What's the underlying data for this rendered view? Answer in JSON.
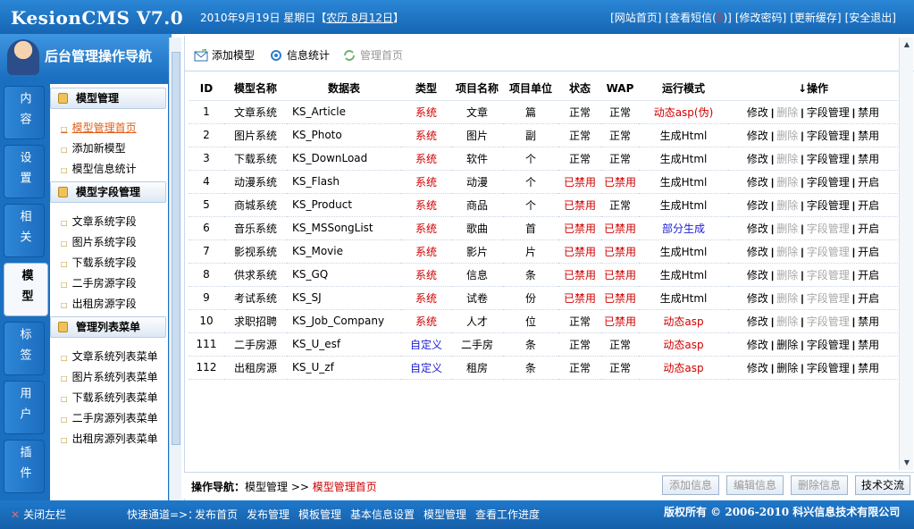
{
  "header": {
    "logo": "KesionCMS V7.0",
    "date": "2010年9月19日 星期日【",
    "lunar": "农历 8月12日",
    "date_close": "】",
    "links": [
      "[网站首页]",
      "[查看短信(",
      "0",
      ")]",
      "[修改密码]",
      "[更新缓存]",
      "[安全退出]"
    ]
  },
  "sidebar": {
    "title": "后台管理操作导航",
    "tabs": [
      "内容",
      "设置",
      "相关",
      "模型",
      "标签",
      "用户",
      "插件"
    ],
    "active_tab": "模型",
    "groups": [
      {
        "title": "模型管理",
        "items": [
          "模型管理首页",
          "添加新模型",
          "模型信息统计"
        ]
      },
      {
        "title": "模型字段管理",
        "items": [
          "文章系统字段",
          "图片系统字段",
          "下载系统字段",
          "二手房源字段",
          "出租房源字段"
        ]
      },
      {
        "title": "管理列表菜单",
        "items": [
          "文章系统列表菜单",
          "图片系统列表菜单",
          "下载系统列表菜单",
          "二手房源列表菜单",
          "出租房源列表菜单"
        ]
      }
    ]
  },
  "toolbar": {
    "add": "添加模型",
    "stats": "信息统计",
    "home": "管理首页"
  },
  "table": {
    "headers": [
      "ID",
      "模型名称",
      "数据表",
      "类型",
      "项目名称",
      "项目单位",
      "状态",
      "WAP",
      "运行模式",
      "↓操作"
    ],
    "rows": [
      {
        "id": "1",
        "name": "文章系统",
        "table": "KS_Article",
        "type": "系统",
        "item": "文章",
        "unit": "篇",
        "status": "正常",
        "wap": "正常",
        "mode": "动态asp(伪)",
        "ops": [
          "修改",
          "删除",
          "字段管理",
          "禁用"
        ]
      },
      {
        "id": "2",
        "name": "图片系统",
        "table": "KS_Photo",
        "type": "系统",
        "item": "图片",
        "unit": "副",
        "status": "正常",
        "wap": "正常",
        "mode": "生成Html",
        "ops": [
          "修改",
          "删除",
          "字段管理",
          "禁用"
        ]
      },
      {
        "id": "3",
        "name": "下载系统",
        "table": "KS_DownLoad",
        "type": "系统",
        "item": "软件",
        "unit": "个",
        "status": "正常",
        "wap": "正常",
        "mode": "生成Html",
        "ops": [
          "修改",
          "删除",
          "字段管理",
          "禁用"
        ]
      },
      {
        "id": "4",
        "name": "动漫系统",
        "table": "KS_Flash",
        "type": "系统",
        "item": "动漫",
        "unit": "个",
        "status": "已禁用",
        "wap": "已禁用",
        "mode": "生成Html",
        "ops": [
          "修改",
          "删除",
          "字段管理",
          "开启"
        ]
      },
      {
        "id": "5",
        "name": "商城系统",
        "table": "KS_Product",
        "type": "系统",
        "item": "商品",
        "unit": "个",
        "status": "已禁用",
        "wap": "正常",
        "mode": "生成Html",
        "ops": [
          "修改",
          "删除",
          "字段管理",
          "开启"
        ]
      },
      {
        "id": "6",
        "name": "音乐系统",
        "table": "KS_MSSongList",
        "type": "系统",
        "item": "歌曲",
        "unit": "首",
        "status": "已禁用",
        "wap": "已禁用",
        "mode": "部分生成",
        "ops": [
          "修改",
          "删除",
          "字段管理",
          "开启"
        ]
      },
      {
        "id": "7",
        "name": "影视系统",
        "table": "KS_Movie",
        "type": "系统",
        "item": "影片",
        "unit": "片",
        "status": "已禁用",
        "wap": "已禁用",
        "mode": "生成Html",
        "ops": [
          "修改",
          "删除",
          "字段管理",
          "开启"
        ]
      },
      {
        "id": "8",
        "name": "供求系统",
        "table": "KS_GQ",
        "type": "系统",
        "item": "信息",
        "unit": "条",
        "status": "已禁用",
        "wap": "已禁用",
        "mode": "生成Html",
        "ops": [
          "修改",
          "删除",
          "字段管理",
          "开启"
        ]
      },
      {
        "id": "9",
        "name": "考试系统",
        "table": "KS_SJ",
        "type": "系统",
        "item": "试卷",
        "unit": "份",
        "status": "已禁用",
        "wap": "已禁用",
        "mode": "生成Html",
        "ops": [
          "修改",
          "删除",
          "字段管理",
          "开启"
        ]
      },
      {
        "id": "10",
        "name": "求职招聘",
        "table": "KS_Job_Company",
        "type": "系统",
        "item": "人才",
        "unit": "位",
        "status": "正常",
        "wap": "已禁用",
        "mode": "动态asp",
        "ops": [
          "修改",
          "删除",
          "字段管理",
          "禁用"
        ]
      },
      {
        "id": "111",
        "name": "二手房源",
        "table": "KS_U_esf",
        "type": "自定义",
        "item": "二手房",
        "unit": "条",
        "status": "正常",
        "wap": "正常",
        "mode": "动态asp",
        "ops": [
          "修改",
          "删除",
          "字段管理",
          "禁用"
        ]
      },
      {
        "id": "112",
        "name": "出租房源",
        "table": "KS_U_zf",
        "type": "自定义",
        "item": "租房",
        "unit": "条",
        "status": "正常",
        "wap": "正常",
        "mode": "动态asp",
        "ops": [
          "修改",
          "删除",
          "字段管理",
          "禁用"
        ]
      }
    ]
  },
  "bottom": {
    "crumb_label": "操作导航：",
    "crumb_1": "模型管理",
    "crumb_sep": ">>",
    "crumb_2": "模型管理首页",
    "buttons": [
      "添加信息",
      "编辑信息",
      "删除信息",
      "技术交流"
    ]
  },
  "footer": {
    "close": "关闭左栏",
    "quick": "快速通道=>：",
    "links": [
      "发布首页",
      "发布管理",
      "模板管理",
      "基本信息设置",
      "模型管理",
      "查看工作进度"
    ],
    "copyright": "版权所有 © 2006-2010 科兴信息技术有限公司"
  }
}
